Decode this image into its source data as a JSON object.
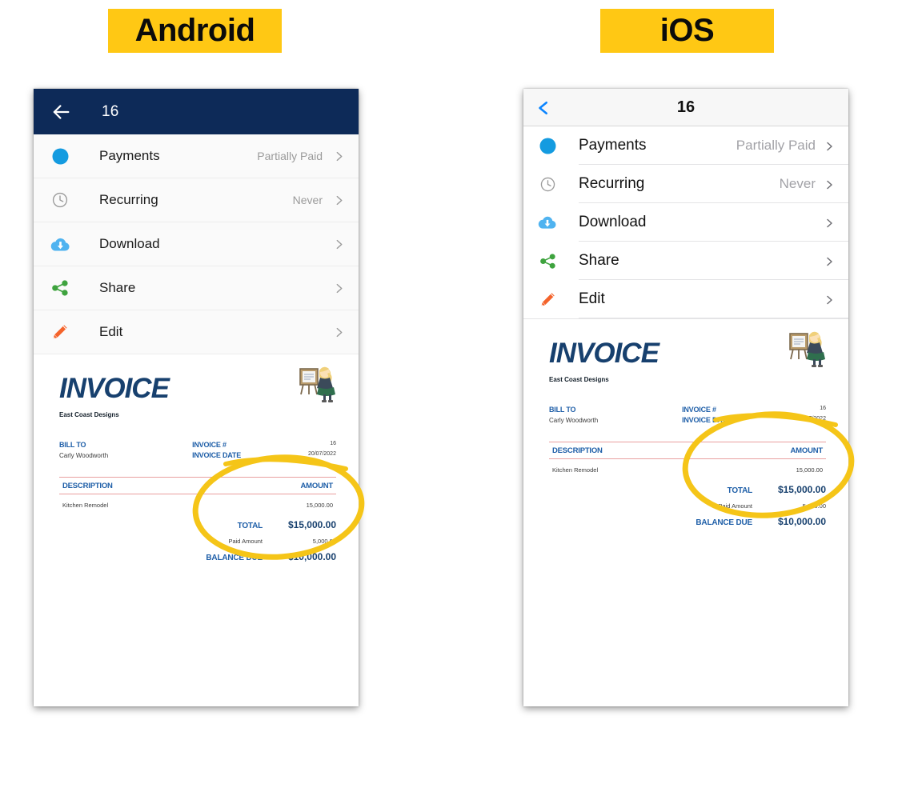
{
  "badges": {
    "android": "Android",
    "ios": "iOS"
  },
  "colors": {
    "badge_yellow": "#FFC814",
    "android_appbar_navy": "#0D2A58",
    "ios_tint_blue": "#0A84FF",
    "annotation_yellow": "#F5C518",
    "payments_dot_blue": "#149BE0",
    "download_cloud_blue": "#4FB3F0",
    "share_green": "#3EA33E",
    "edit_pencil_orange": "#F4632B",
    "invoice_navy": "#17406E",
    "invoice_label_blue": "#1F5FA8",
    "invoice_rule_red": "#E9A0A0"
  },
  "android": {
    "appbar": {
      "back_icon": "arrow-left-icon",
      "title": "16"
    },
    "rows": [
      {
        "icon": "payments-dot-icon",
        "label": "Payments",
        "value": "Partially Paid",
        "chevron": "chevron-right-icon"
      },
      {
        "icon": "clock-icon",
        "label": "Recurring",
        "value": "Never",
        "chevron": "chevron-right-icon"
      },
      {
        "icon": "cloud-download-icon",
        "label": "Download",
        "value": "",
        "chevron": "chevron-right-icon"
      },
      {
        "icon": "share-icon",
        "label": "Share",
        "value": "",
        "chevron": "chevron-right-icon"
      },
      {
        "icon": "pencil-icon",
        "label": "Edit",
        "value": "",
        "chevron": "chevron-right-icon"
      }
    ]
  },
  "ios": {
    "appbar": {
      "back_icon": "chevron-left-icon",
      "title": "16"
    },
    "rows": [
      {
        "icon": "payments-dot-icon",
        "label": "Payments",
        "value": "Partially Paid",
        "chevron": "chevron-right-icon"
      },
      {
        "icon": "clock-icon",
        "label": "Recurring",
        "value": "Never",
        "chevron": "chevron-right-icon"
      },
      {
        "icon": "cloud-download-icon",
        "label": "Download",
        "value": "",
        "chevron": "chevron-right-icon"
      },
      {
        "icon": "share-icon",
        "label": "Share",
        "value": "",
        "chevron": "chevron-right-icon"
      },
      {
        "icon": "pencil-icon",
        "label": "Edit",
        "value": "",
        "chevron": "chevron-right-icon"
      }
    ]
  },
  "invoice": {
    "heading": "INVOICE",
    "company": "East Coast Designs",
    "bill_to_label": "BILL TO",
    "bill_to_name": "Carly Woodworth",
    "invoice_no_label": "INVOICE #",
    "invoice_no_value": "16",
    "invoice_date_label": "INVOICE DATE",
    "invoice_date_value": "20/07/2022",
    "table_col_description": "DESCRIPTION",
    "table_col_amount": "AMOUNT",
    "line_item_description": "Kitchen Remodel",
    "line_item_amount": "15,000.00",
    "total_label": "TOTAL",
    "total_value": "$15,000.00",
    "paid_label": "Paid Amount",
    "paid_value": "5,000.00",
    "balance_label": "BALANCE DUE",
    "balance_value": "$10,000.00",
    "illustration": "artist-at-easel-illustration"
  }
}
